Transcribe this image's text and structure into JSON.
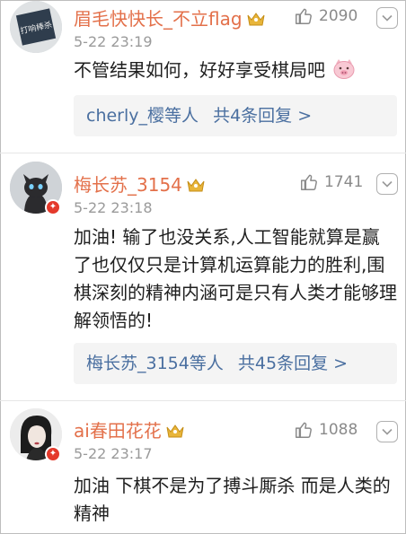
{
  "comments": [
    {
      "username": "眉毛快快长_不立flag",
      "time": "5-22 23:19",
      "likes": "2090",
      "text": "不管结果如何，好好享受棋局吧",
      "emoji_icon": "pig-face-emoji",
      "replies_who": "cherly_樱等人",
      "replies_count": "共4条回复 >",
      "avatar_text": "打响棒杀"
    },
    {
      "username": "梅长苏_3154",
      "time": "5-22 23:18",
      "likes": "1741",
      "text": "加油! 输了也没关系,人工智能就算是赢了也仅仅只是计算机运算能力的胜利,围棋深刻的精神内涵可是只有人类才能够理解领悟的!",
      "replies_who": "梅长苏_3154等人",
      "replies_count": "共45条回复 >"
    },
    {
      "username": "ai春田花花",
      "time": "5-22 23:17",
      "likes": "1088",
      "text": "加油 下棋不是为了搏斗厮杀 而是人类的精神"
    }
  ],
  "colors": {
    "username": "#e3704a",
    "link": "#4a6fa0",
    "muted": "#9a9a9a",
    "vip_badge": "#e4392b",
    "crown": "#e8b53a"
  },
  "icons": [
    "thumbs-up-icon",
    "chevron-down-icon",
    "crown-icon",
    "vip-badge-icon"
  ]
}
